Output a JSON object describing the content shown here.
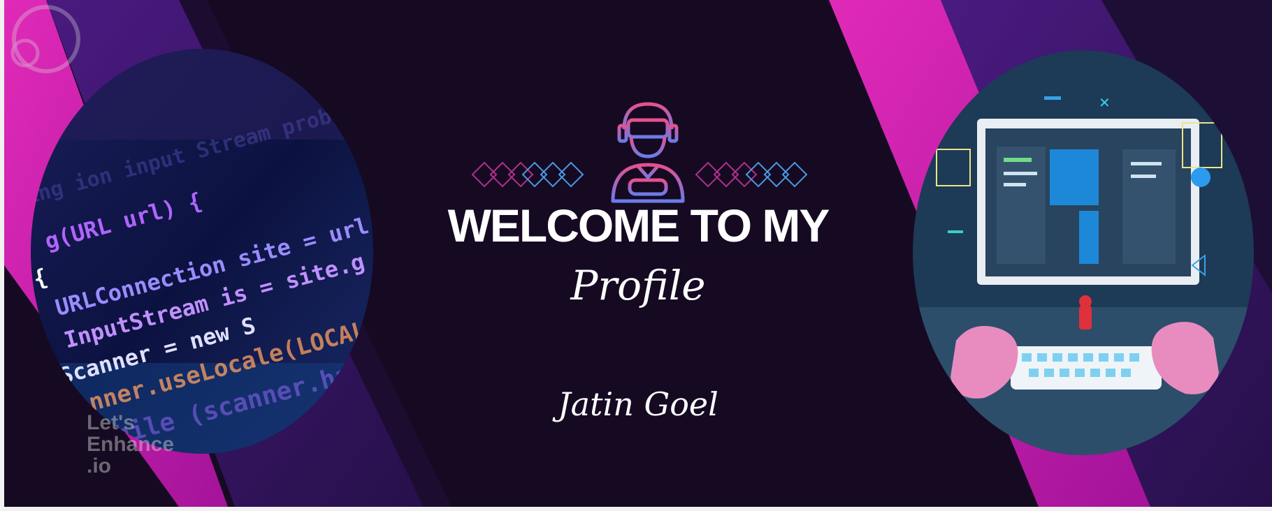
{
  "banner": {
    "heading": "WELCOME TO MY",
    "subheading": "Profile",
    "name": "Jatin Goel"
  },
  "code_image": {
    "lines": [
      "ing  ion  input  Stream  prob  u",
      "g(URL url) {",
      "{",
      "URLConnection site = url.ope",
      "InputStream is    = site.g",
      "Scanner          = new S",
      "canner.useLocale(LOCALE)",
      "(  while  (scanner.hasNext  ("
    ]
  },
  "watermark": {
    "text": "Let's\nEnhance\n.io"
  },
  "colors": {
    "background": "#150a22",
    "magenta": "#c81aa8",
    "purple": "#3a1570",
    "accent_pink": "#e0408a",
    "accent_blue": "#3aa0e8"
  }
}
